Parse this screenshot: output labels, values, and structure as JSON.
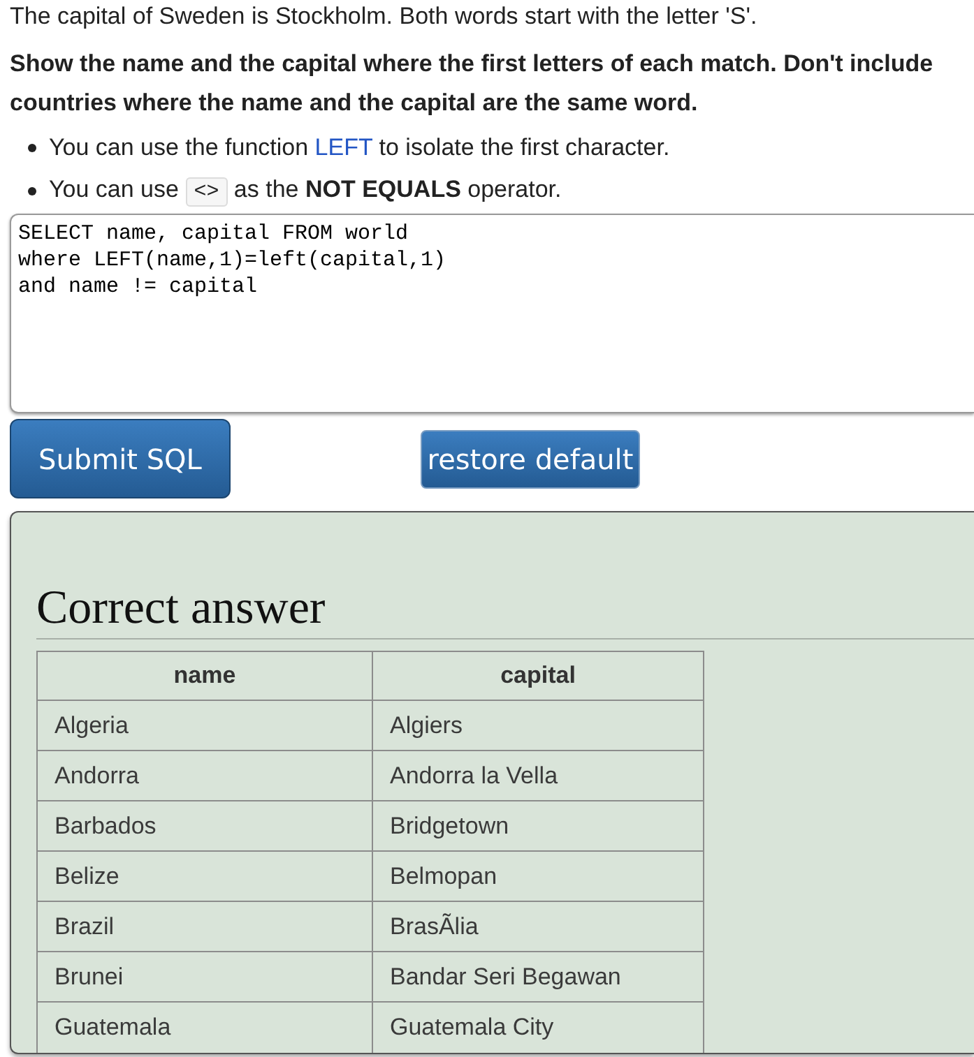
{
  "intro": "The capital of Sweden is Stockholm. Both words start with the letter 'S'.",
  "task": "Show the name and the capital where the first letters of each match. Don't include countries where the name and the capital are the same word.",
  "hints": [
    {
      "segments": [
        {
          "kind": "text",
          "text": "You can use the function "
        },
        {
          "kind": "link",
          "text": "LEFT"
        },
        {
          "kind": "text",
          "text": " to isolate the first character."
        }
      ]
    },
    {
      "segments": [
        {
          "kind": "text",
          "text": "You can use "
        },
        {
          "kind": "code",
          "text": "<>"
        },
        {
          "kind": "text",
          "text": " as the **NOT EQUALS** operator."
        }
      ]
    }
  ],
  "editor": {
    "value": "SELECT name, capital FROM world\nwhere LEFT(name,1)=left(capital,1)\nand name != capital"
  },
  "buttons": [
    {
      "label": "Submit SQL",
      "kind": "submit"
    },
    {
      "label": "restore default",
      "kind": "reset"
    }
  ],
  "result": {
    "title": "Correct answer",
    "table": {
      "columns": [
        "name",
        "capital"
      ],
      "rows": [
        [
          "Algeria",
          "Algiers"
        ],
        [
          "Andorra",
          "Andorra la Vella"
        ],
        [
          "Barbados",
          "Bridgetown"
        ],
        [
          "Belize",
          "Belmopan"
        ],
        [
          "Brazil",
          "BrasÃlia"
        ],
        [
          "Brunei",
          "Bandar Seri Begawan"
        ],
        [
          "Guatemala",
          "Guatemala City"
        ]
      ]
    }
  }
}
